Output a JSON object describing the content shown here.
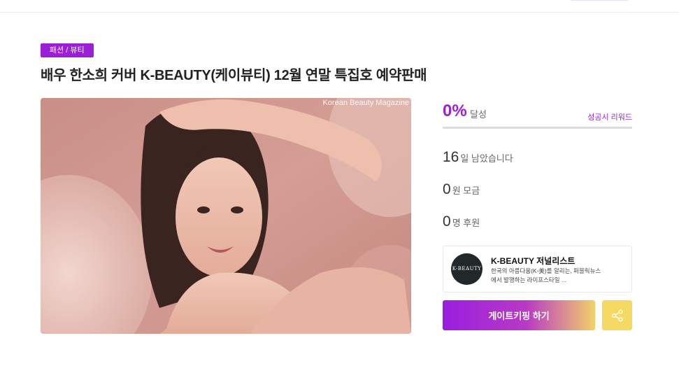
{
  "category_badge": "패션 / 뷰티",
  "title": "배우 한소희 커버 K-BEAUTY(케이뷰티) 12월 연말 특집호 예약판매",
  "hero": {
    "caption": "Korean Beauty Magazine"
  },
  "funding": {
    "percent": "0%",
    "percent_label": "달성",
    "progress": 0,
    "reward_link": "성공시 리워드",
    "days_left": {
      "value": "16",
      "unit": "일 남았습니다"
    },
    "raised": {
      "value": "0",
      "unit": "원 모금"
    },
    "backers": {
      "value": "0",
      "unit": "명 후원"
    }
  },
  "creator": {
    "avatar_text": "K-BEAUTY",
    "name": "K-BEAUTY 저널리스트",
    "description": "한국의 아름다움(K-美)를 알리는, 퍼블릭뉴스에서 발행하는 라이프스타일 ..."
  },
  "actions": {
    "gatekeeping_label": "게이트키핑 하기",
    "share_icon": "share-icon"
  },
  "colors": {
    "accent": "#9b1fd6",
    "share_bg": "#f6d963"
  }
}
